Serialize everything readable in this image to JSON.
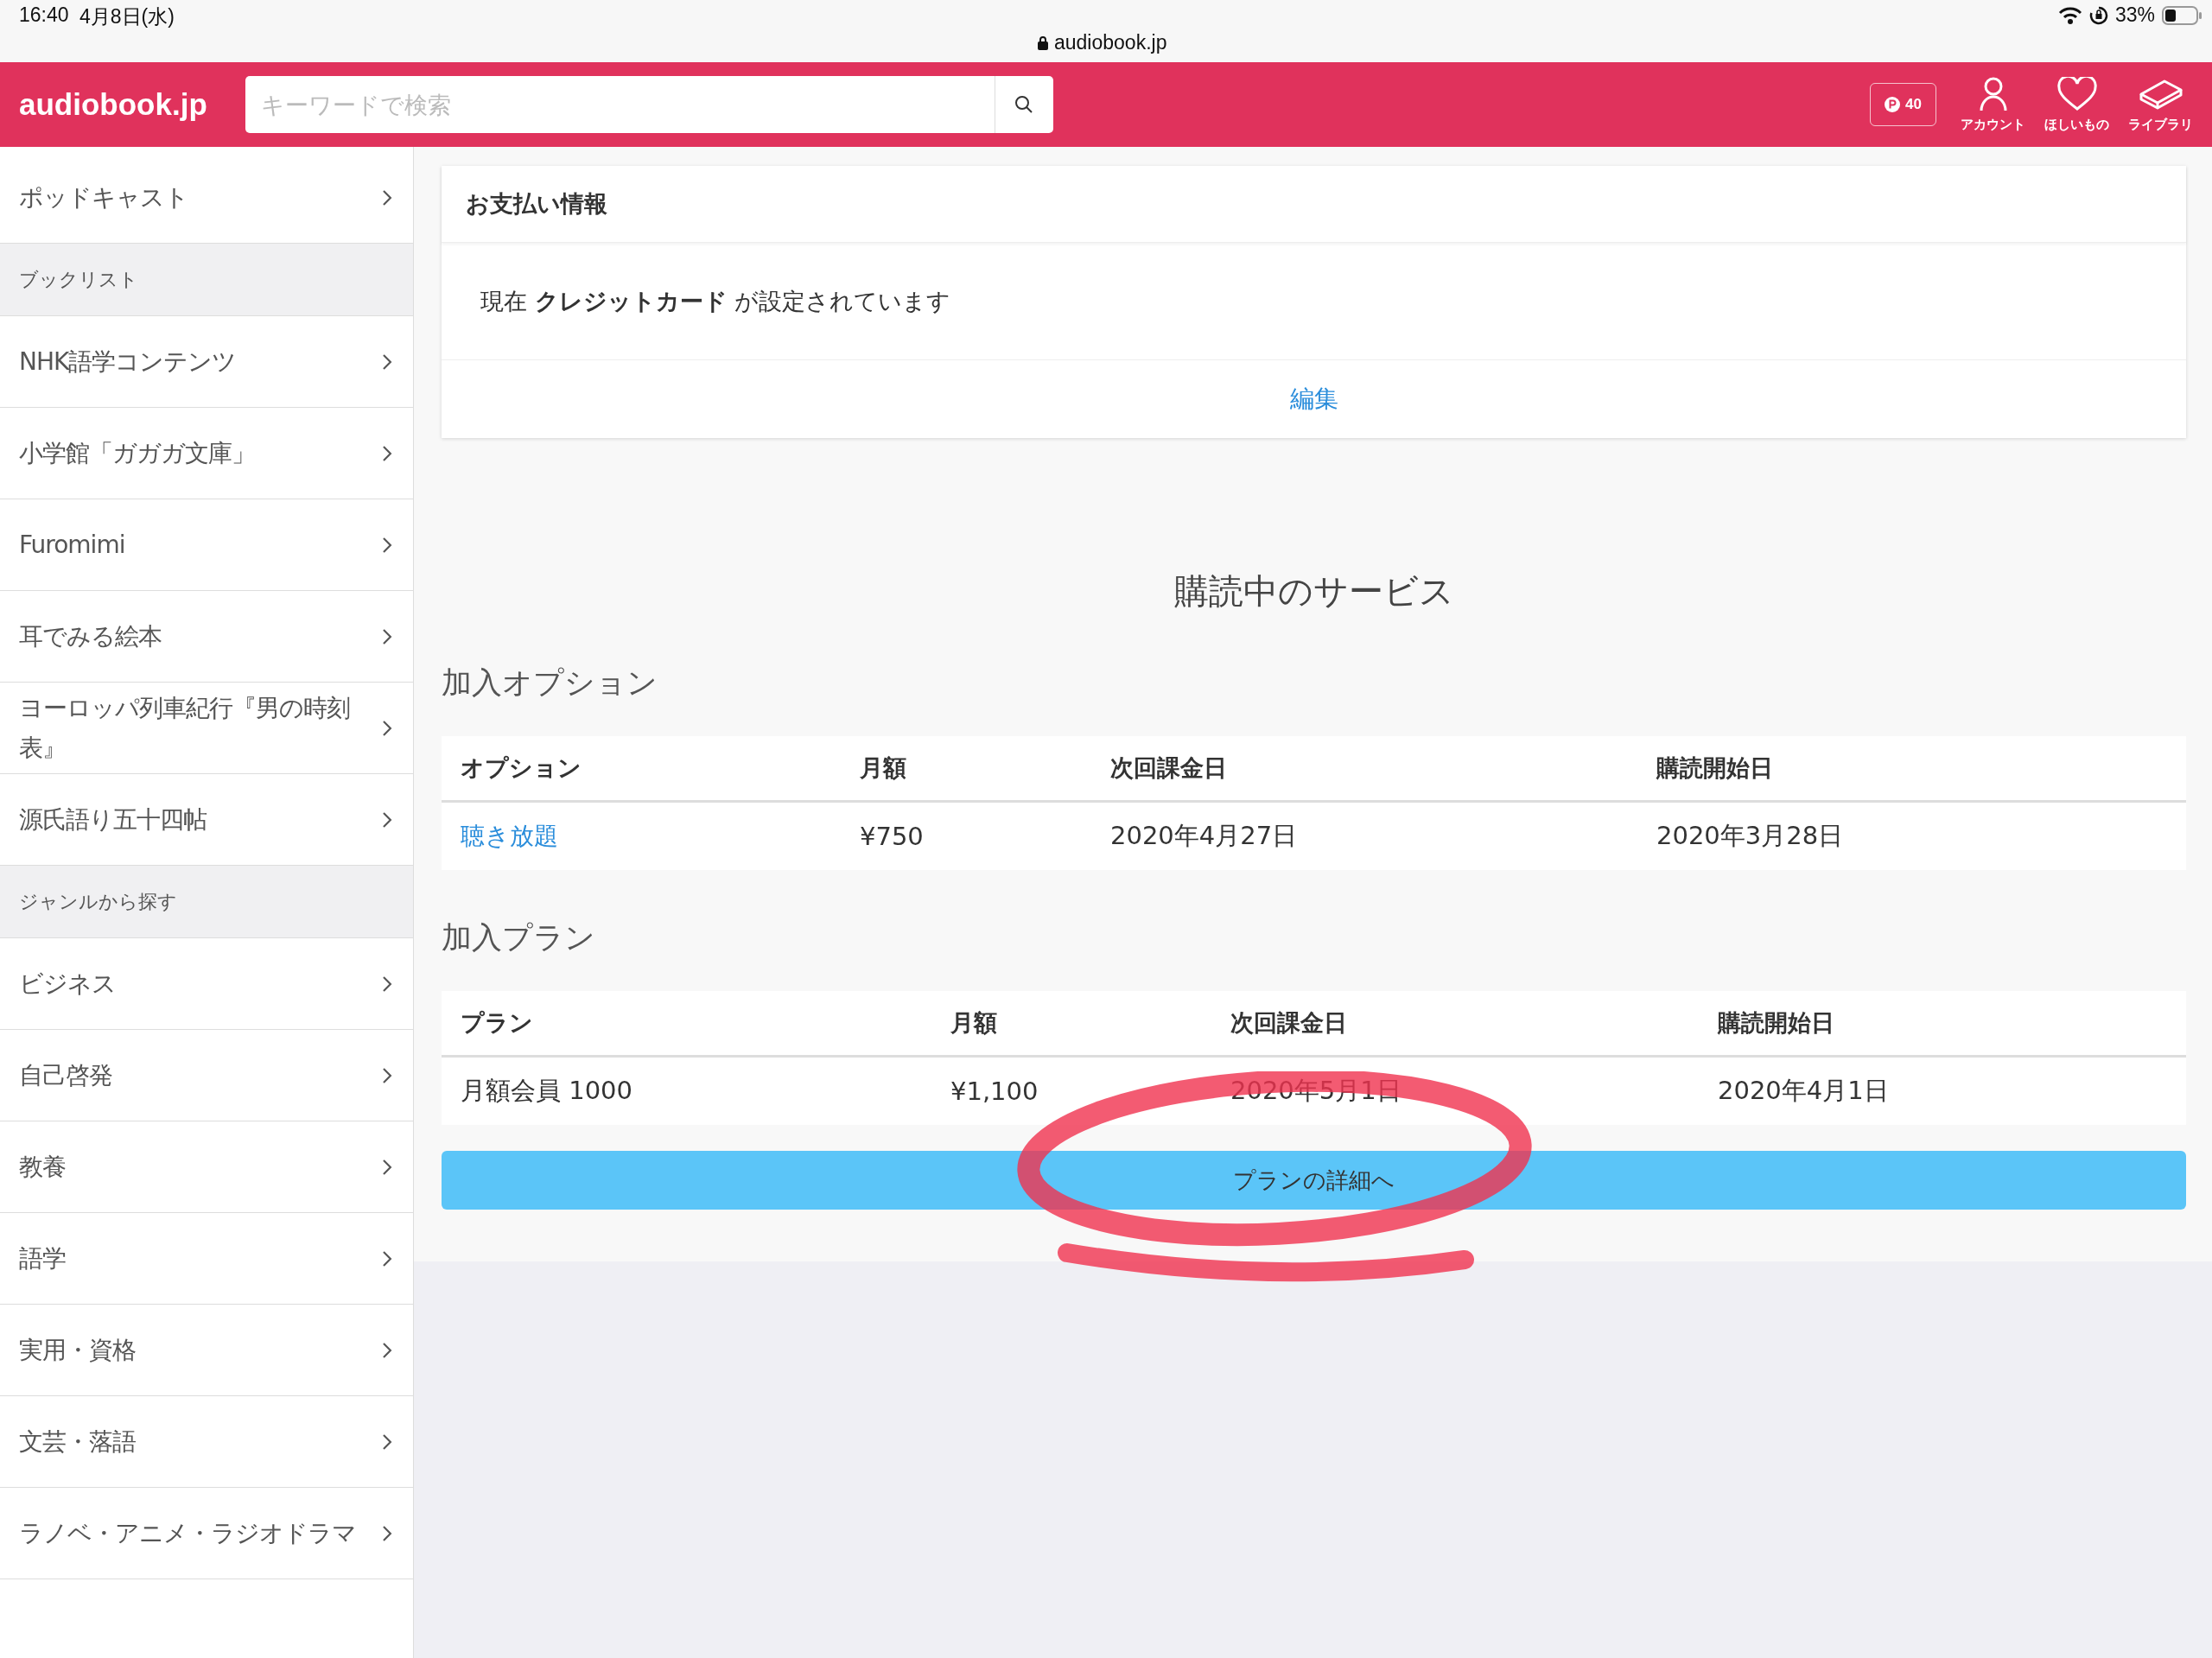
{
  "status_bar": {
    "time": "16:40",
    "date": "4月8日(水)",
    "url": "audiobook.jp",
    "battery": "33%"
  },
  "header": {
    "logo": "audiobook.jp",
    "search": {
      "placeholder": "キーワードで検索"
    },
    "points": "40",
    "nav": [
      {
        "label": "アカウント",
        "kind": "account"
      },
      {
        "label": "ほしいもの",
        "kind": "wishlist"
      },
      {
        "label": "ライブラリ",
        "kind": "library"
      }
    ]
  },
  "sidebar": {
    "items": [
      {
        "kind": "link",
        "label": "ポッドキャスト"
      },
      {
        "kind": "section",
        "label": "ブックリスト"
      },
      {
        "kind": "link",
        "label": "NHK語学コンテンツ"
      },
      {
        "kind": "link",
        "label": "小学館「ガガガ文庫」"
      },
      {
        "kind": "link",
        "label": "Furomimi"
      },
      {
        "kind": "link",
        "label": "耳でみる絵本"
      },
      {
        "kind": "link",
        "label": "ヨーロッパ列車紀行『男の時刻表』"
      },
      {
        "kind": "link",
        "label": "源氏語り五十四帖"
      },
      {
        "kind": "section",
        "label": "ジャンルから探す"
      },
      {
        "kind": "link",
        "label": "ビジネス"
      },
      {
        "kind": "link",
        "label": "自己啓発"
      },
      {
        "kind": "link",
        "label": "教養"
      },
      {
        "kind": "link",
        "label": "語学"
      },
      {
        "kind": "link",
        "label": "実用・資格"
      },
      {
        "kind": "link",
        "label": "文芸・落語"
      },
      {
        "kind": "link",
        "label": "ラノベ・アニメ・ラジオドラマ"
      }
    ]
  },
  "payment": {
    "title": "お支払い情報",
    "text": "現在 **クレジットカード** が設定されています",
    "edit_link": "編集"
  },
  "subscriptions": {
    "title": "購読中のサービス",
    "tables": [
      {
        "heading": "加入オプション",
        "columns": [
          "オプション",
          "月額",
          "次回課金日",
          "購読開始日"
        ],
        "rows": [
          {
            "cells": [
              {
                "kind": "link",
                "text": "聴き放題"
              },
              {
                "kind": "text",
                "text": "¥750"
              },
              {
                "kind": "text",
                "text": "2020年4月27日"
              },
              {
                "kind": "text",
                "text": "2020年3月28日"
              }
            ]
          }
        ]
      },
      {
        "heading": "加入プラン",
        "columns": [
          "プラン",
          "月額",
          "次回課金日",
          "購読開始日"
        ],
        "rows": [
          {
            "cells": [
              {
                "kind": "text",
                "text": "月額会員 1000"
              },
              {
                "kind": "text",
                "text": "¥1,100"
              },
              {
                "kind": "text",
                "text": "2020年5月1日"
              },
              {
                "kind": "text",
                "text": "2020年4月1日"
              }
            ]
          }
        ]
      }
    ],
    "button": "プランの詳細へ"
  }
}
